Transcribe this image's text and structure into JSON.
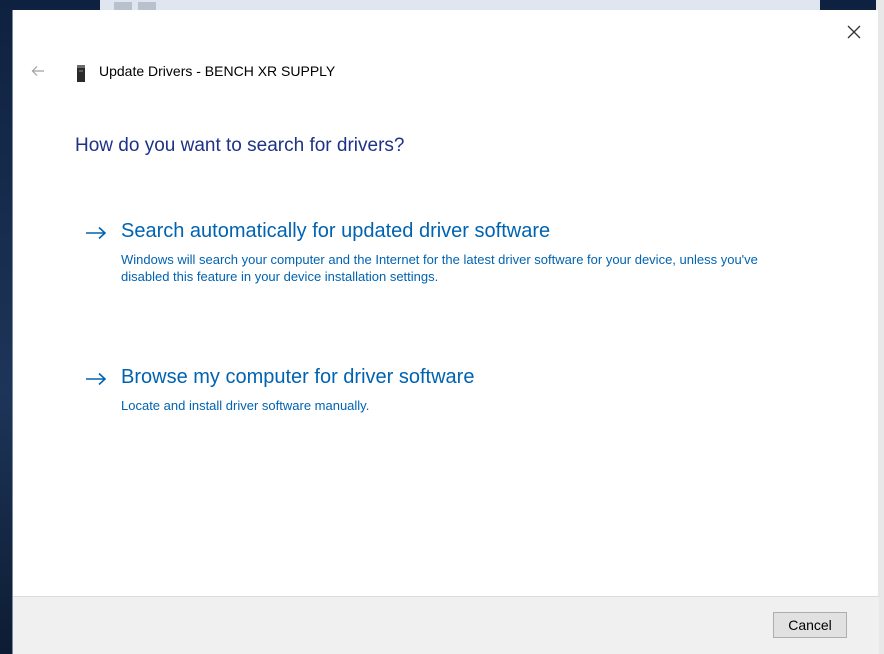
{
  "window": {
    "title": "Update Drivers - BENCH XR SUPPLY",
    "close_icon": "close-icon",
    "back_icon": "back-arrow-icon",
    "device_icon": "usb-device-icon"
  },
  "main": {
    "heading": "How do you want to search for drivers?",
    "options": [
      {
        "icon": "right-arrow-icon",
        "title": "Search automatically for updated driver software",
        "description": "Windows will search your computer and the Internet for the latest driver software for your device, unless you've disabled this feature in your device installation settings."
      },
      {
        "icon": "right-arrow-icon",
        "title": "Browse my computer for driver software",
        "description": "Locate and install driver software manually."
      }
    ]
  },
  "footer": {
    "cancel_label": "Cancel"
  },
  "colors": {
    "heading": "#1e3287",
    "link": "#0063b1",
    "footer_bg": "#f0f0f0",
    "button_bg": "#e1e1e1"
  }
}
